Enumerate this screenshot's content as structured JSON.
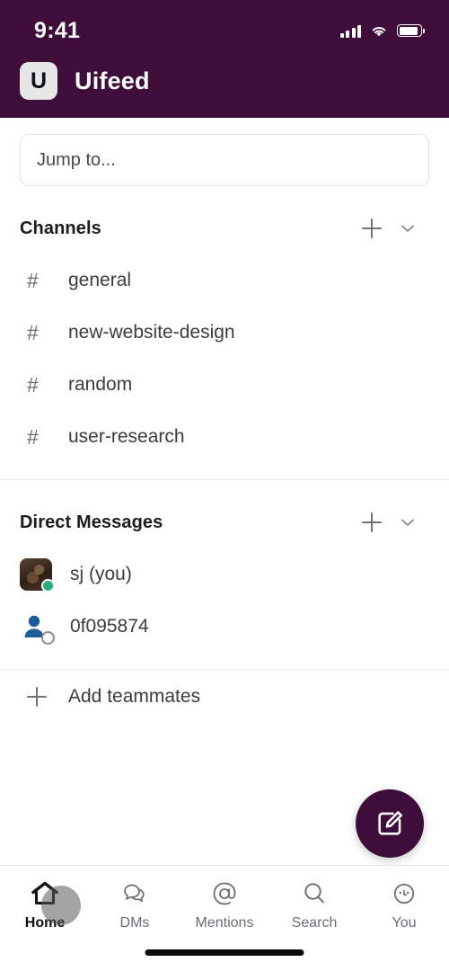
{
  "status_bar": {
    "time": "9:41",
    "signal_icon": "cellular-signal-icon",
    "wifi_icon": "wifi-icon",
    "battery_icon": "battery-icon"
  },
  "header": {
    "workspace_initial": "U",
    "workspace_name": "Uifeed",
    "background_color": "#3E0D3A"
  },
  "search": {
    "value": "",
    "placeholder": "Jump to..."
  },
  "channels_section": {
    "title": "Channels",
    "add_icon": "plus-icon",
    "collapse_icon": "chevron-down-icon",
    "items": [
      {
        "prefix": "#",
        "name": "general"
      },
      {
        "prefix": "#",
        "name": "new-website-design"
      },
      {
        "prefix": "#",
        "name": "random"
      },
      {
        "prefix": "#",
        "name": "user-research"
      }
    ]
  },
  "dm_section": {
    "title": "Direct Messages",
    "add_icon": "plus-icon",
    "collapse_icon": "chevron-down-icon",
    "items": [
      {
        "name": "sj (you)",
        "avatar": "photo-avatar",
        "presence": "online",
        "presence_color": "#2BAC76"
      },
      {
        "name": "0f095874",
        "avatar": "default-person-avatar",
        "presence": "offline",
        "presence_color": "#FFFFFF"
      }
    ]
  },
  "add_teammates": {
    "label": "Add teammates",
    "icon": "plus-icon"
  },
  "compose_button": {
    "icon": "compose-pencil-icon",
    "color": "#3E0D3A"
  },
  "tab_bar": {
    "items": [
      {
        "label": "Home",
        "icon": "home-icon",
        "active": true
      },
      {
        "label": "DMs",
        "icon": "chat-bubbles-icon",
        "active": false
      },
      {
        "label": "Mentions",
        "icon": "at-sign-icon",
        "active": false
      },
      {
        "label": "Search",
        "icon": "magnifier-icon",
        "active": false
      },
      {
        "label": "You",
        "icon": "face-avatar-icon",
        "active": false
      }
    ]
  }
}
